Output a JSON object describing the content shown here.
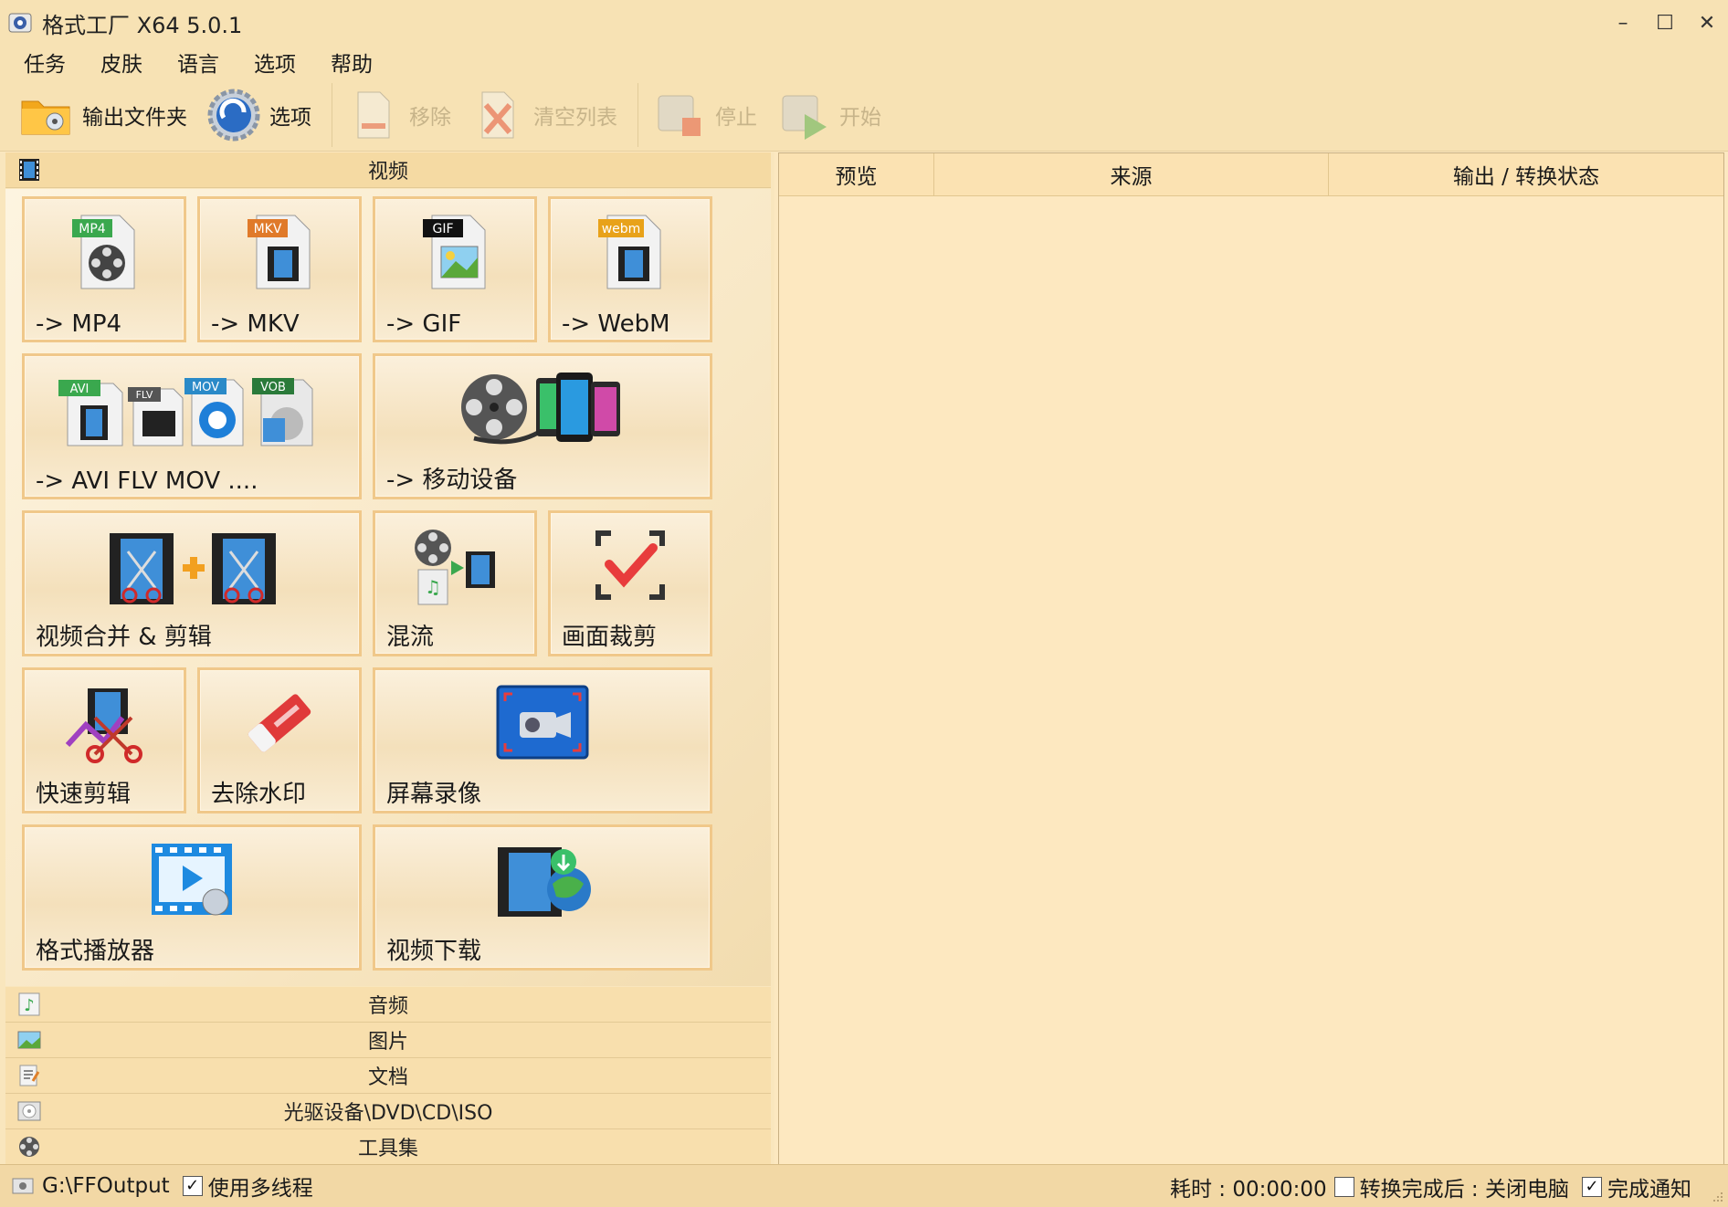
{
  "window": {
    "title": "格式工厂 X64 5.0.1",
    "minimize": "–",
    "maximize": "☐",
    "close": "✕"
  },
  "menu": [
    "任务",
    "皮肤",
    "语言",
    "选项",
    "帮助"
  ],
  "toolbar": {
    "output_folder": "输出文件夹",
    "options": "选项",
    "remove": "移除",
    "clear_list": "清空列表",
    "stop": "停止",
    "start": "开始"
  },
  "video_category": {
    "label": "视频",
    "tiles": [
      {
        "label": "-> MP4",
        "badge": "MP4",
        "badge_color": "#3aa84e"
      },
      {
        "label": "-> MKV",
        "badge": "MKV",
        "badge_color": "#e07a2a"
      },
      {
        "label": "-> GIF",
        "badge": "GIF",
        "badge_color": "#111111"
      },
      {
        "label": "-> WebM",
        "badge": "webm",
        "badge_color": "#e8a21a"
      },
      {
        "label": "-> AVI FLV MOV ...."
      },
      {
        "label": "-> 移动设备"
      },
      {
        "label": "视频合并 & 剪辑"
      },
      {
        "label": "混流"
      },
      {
        "label": "画面裁剪"
      },
      {
        "label": "快速剪辑"
      },
      {
        "label": "去除水印"
      },
      {
        "label": "屏幕录像"
      },
      {
        "label": "格式播放器"
      },
      {
        "label": "视频下载"
      }
    ],
    "multi_badges": [
      "AVI",
      "FLV",
      "MOV",
      "VOB"
    ]
  },
  "other_categories": {
    "audio": "音频",
    "image": "图片",
    "document": "文档",
    "disc": "光驱设备\\DVD\\CD\\ISO",
    "tools": "工具集"
  },
  "task_list": {
    "columns": [
      "预览",
      "来源",
      "输出 / 转换状态"
    ]
  },
  "statusbar": {
    "output_path": "G:\\FFOutput",
    "multithread_label": "使用多线程",
    "multithread_checked": "✓",
    "elapsed": "耗时 : 00:00:00",
    "after_convert": "转换完成后 : 关闭电脑",
    "notify_label": "完成通知",
    "notify_checked": "✓"
  },
  "colors": {
    "accent_orange": "#f0c88a",
    "panel_bg": "#fde8c0",
    "check_red": "#e83c3c"
  }
}
